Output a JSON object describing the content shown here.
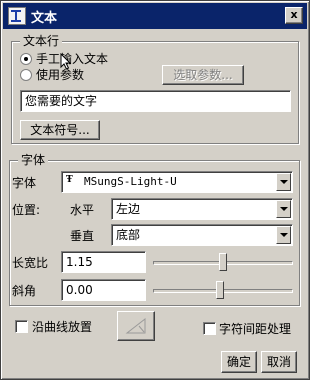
{
  "window": {
    "title": "文本",
    "close_label": "x"
  },
  "text_line": {
    "group_label": "文本行",
    "manual_label": "手工输入文本",
    "manual_checked": true,
    "param_label": "使用参数",
    "param_checked": false,
    "select_param_button": "选取参数...",
    "text_value": "您需要的文字",
    "symbol_button": "文本符号..."
  },
  "font_group": {
    "group_label": "字体",
    "font_label": "字体",
    "font_value": "MSungS-Light-U",
    "position_label": "位置:",
    "horizontal_label": "水平",
    "horizontal_value": "左边",
    "vertical_label": "垂直",
    "vertical_value": "底部",
    "aspect_label": "长宽比",
    "aspect_value": "1.15",
    "aspect_slider_level": 0.5,
    "slant_label": "斜角",
    "slant_value": "0.00",
    "slant_slider_level": 0.48
  },
  "options": {
    "along_curve_label": "沿曲线放置",
    "along_curve_checked": false,
    "char_spacing_label": "字符间距处理",
    "char_spacing_checked": false
  },
  "footer": {
    "ok_label": "确定",
    "cancel_label": "取消"
  },
  "icons": {
    "app": "text-icon",
    "font_type": "truetype-font-icon",
    "flip": "flip-direction-icon",
    "cursor": "mouse-pointer-icon"
  }
}
